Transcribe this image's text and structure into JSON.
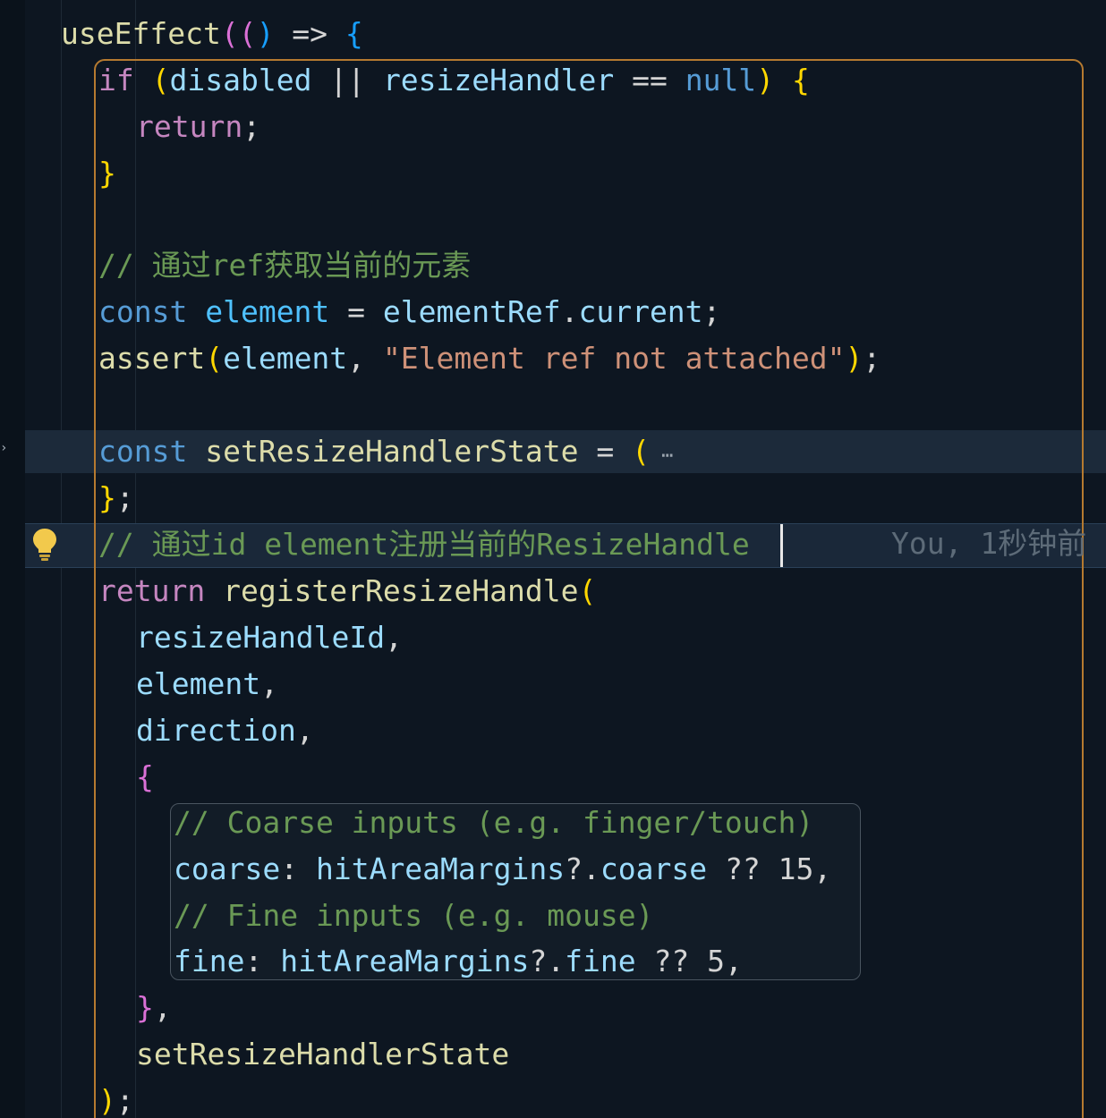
{
  "editor": {
    "lines": [
      {
        "id": "l1",
        "tokens": [
          [
            "fn",
            "useEffect"
          ],
          [
            "b2",
            "(("
          ],
          [
            "b3",
            ")"
          ],
          [
            "op",
            " => "
          ],
          [
            "b3",
            "{"
          ]
        ]
      },
      {
        "id": "l2",
        "tokens": [
          [
            "kw-ctl",
            "if"
          ],
          [
            "op",
            " "
          ],
          [
            "b1",
            "("
          ],
          [
            "var",
            "disabled"
          ],
          [
            "op",
            " || "
          ],
          [
            "var",
            "resizeHandler"
          ],
          [
            "op",
            " == "
          ],
          [
            "kw",
            "null"
          ],
          [
            "b1",
            ")"
          ],
          [
            "op",
            " "
          ],
          [
            "b1",
            "{"
          ]
        ]
      },
      {
        "id": "l3",
        "tokens": [
          [
            "kw-ctl",
            "return"
          ],
          [
            "op",
            ";"
          ]
        ]
      },
      {
        "id": "l4",
        "tokens": [
          [
            "b1",
            "}"
          ]
        ]
      },
      {
        "id": "l5",
        "tokens": [
          [
            "com",
            "// 通过ref获取当前的元素"
          ]
        ]
      },
      {
        "id": "l6",
        "tokens": [
          [
            "kw",
            "const"
          ],
          [
            "op",
            " "
          ],
          [
            "const",
            "element"
          ],
          [
            "op",
            " = "
          ],
          [
            "var",
            "elementRef"
          ],
          [
            "op",
            "."
          ],
          [
            "var",
            "current"
          ],
          [
            "op",
            ";"
          ]
        ]
      },
      {
        "id": "l7",
        "tokens": [
          [
            "fn",
            "assert"
          ],
          [
            "b1",
            "("
          ],
          [
            "var",
            "element"
          ],
          [
            "op",
            ", "
          ],
          [
            "str",
            "\"Element ref not attached\""
          ],
          [
            "b1",
            ")"
          ],
          [
            "op",
            ";"
          ]
        ]
      },
      {
        "id": "l8",
        "tokens": [
          [
            "kw",
            "const"
          ],
          [
            "op",
            " "
          ],
          [
            "fn",
            "setResizeHandlerState"
          ],
          [
            "op",
            " = "
          ],
          [
            "b1",
            "("
          ],
          [
            "ellipsis",
            " ⋯"
          ]
        ]
      },
      {
        "id": "l9",
        "tokens": [
          [
            "b1",
            "}"
          ],
          [
            "op",
            ";"
          ]
        ]
      },
      {
        "id": "l10",
        "tokens": [
          [
            "com",
            "// 通过id element注册当前的ResizeHandle"
          ]
        ]
      },
      {
        "id": "l11",
        "tokens": [
          [
            "kw-ctl",
            "return"
          ],
          [
            "op",
            " "
          ],
          [
            "fn",
            "registerResizeHandle"
          ],
          [
            "b1",
            "("
          ]
        ]
      },
      {
        "id": "l12",
        "tokens": [
          [
            "var",
            "resizeHandleId"
          ],
          [
            "op",
            ","
          ]
        ]
      },
      {
        "id": "l13",
        "tokens": [
          [
            "var",
            "element"
          ],
          [
            "op",
            ","
          ]
        ]
      },
      {
        "id": "l14",
        "tokens": [
          [
            "var",
            "direction"
          ],
          [
            "op",
            ","
          ]
        ]
      },
      {
        "id": "l15",
        "tokens": [
          [
            "b2",
            "{"
          ]
        ]
      },
      {
        "id": "l16",
        "tokens": [
          [
            "com",
            "// Coarse inputs (e.g. finger/touch)"
          ]
        ]
      },
      {
        "id": "l17",
        "tokens": [
          [
            "var",
            "coarse"
          ],
          [
            "op",
            ": "
          ],
          [
            "var",
            "hitAreaMargins"
          ],
          [
            "op",
            "?."
          ],
          [
            "var",
            "coarse"
          ],
          [
            "op",
            " ?? "
          ],
          [
            "op",
            "15"
          ],
          [
            "op",
            ","
          ]
        ]
      },
      {
        "id": "l18",
        "tokens": [
          [
            "com",
            "// Fine inputs (e.g. mouse)"
          ]
        ]
      },
      {
        "id": "l19",
        "tokens": [
          [
            "var",
            "fine"
          ],
          [
            "op",
            ": "
          ],
          [
            "var",
            "hitAreaMargins"
          ],
          [
            "op",
            "?."
          ],
          [
            "var",
            "fine"
          ],
          [
            "op",
            " ?? "
          ],
          [
            "op",
            "5"
          ],
          [
            "op",
            ","
          ]
        ]
      },
      {
        "id": "l20",
        "tokens": [
          [
            "b2",
            "}"
          ],
          [
            "op",
            ","
          ]
        ]
      },
      {
        "id": "l21",
        "tokens": [
          [
            "fn",
            "setResizeHandlerState"
          ]
        ]
      },
      {
        "id": "l22",
        "tokens": [
          [
            "b1",
            ")"
          ],
          [
            "op",
            ";"
          ]
        ]
      }
    ],
    "blame": "You, 1秒钟前"
  }
}
